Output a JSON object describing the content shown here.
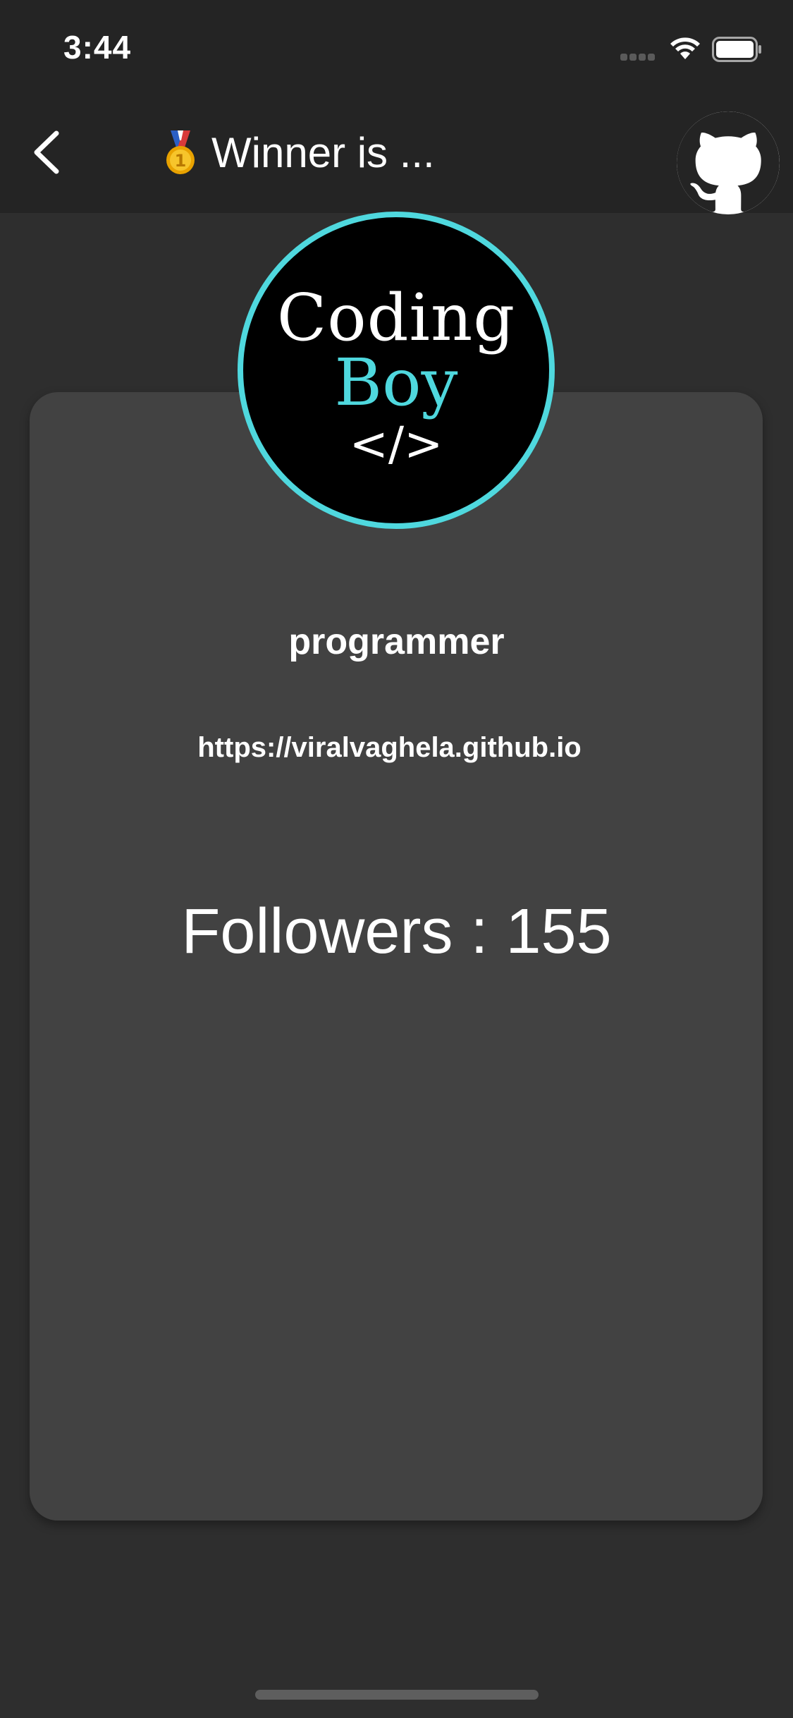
{
  "status_bar": {
    "time": "3:44"
  },
  "nav": {
    "title": "Winner is ...",
    "icons": {
      "back": "chevron-left-icon",
      "medal": "first-place-medal-icon",
      "github": "github-icon"
    }
  },
  "profile": {
    "avatar_line1": "Coding",
    "avatar_line2": "Boy",
    "avatar_code": "</>",
    "username": "programmer",
    "url": "https://viralvaghela.github.io",
    "followers_label": "Followers : ",
    "followers_count": "155"
  },
  "colors": {
    "background": "#2e2e2e",
    "bar": "#242424",
    "card": "#424242",
    "accent": "#4fd8de"
  }
}
